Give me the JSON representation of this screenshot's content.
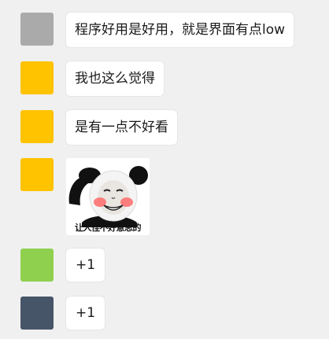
{
  "messages": [
    {
      "avatar_color": "#aaaaaa",
      "text": "程序好用是好用，就是界面有点low"
    },
    {
      "avatar_color": "#ffc300",
      "text": "我也这么觉得"
    },
    {
      "avatar_color": "#ffc300",
      "text": "是有一点不好看"
    },
    {
      "avatar_color": "#ffc300",
      "image": "panda-meme-sticker",
      "caption": "让人怪不好意思的"
    },
    {
      "avatar_color": "#8fd14f",
      "text": "+1"
    },
    {
      "avatar_color": "#475569",
      "text": "+1"
    }
  ]
}
